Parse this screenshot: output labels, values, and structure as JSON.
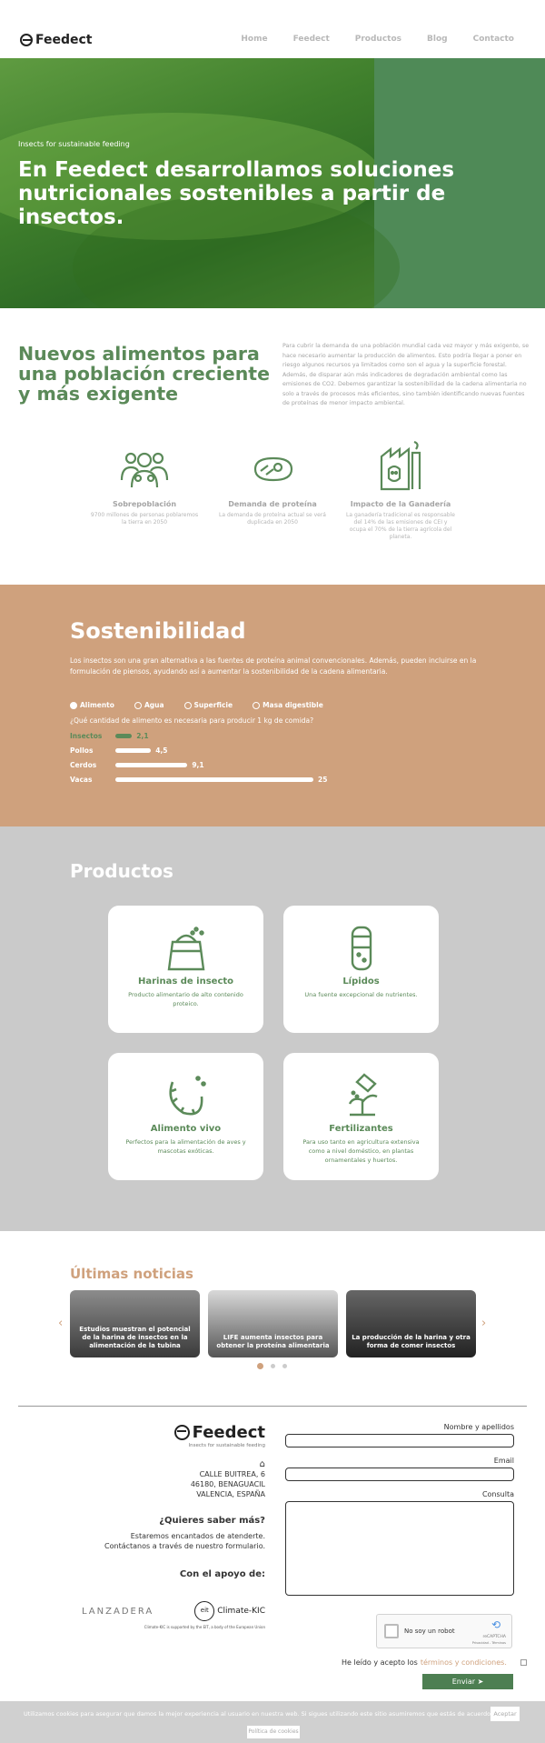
{
  "header": {
    "logo_text": "Feedect",
    "nav": [
      "Home",
      "Feedect",
      "Productos",
      "Blog",
      "Contacto"
    ]
  },
  "hero": {
    "kicker": "Insects for sustainable feeding",
    "title": "En Feedect desarrollamos soluciones nutricionales sostenibles a partir de insectos."
  },
  "intro": {
    "heading": "Nuevos alimentos para una población creciente y más exigente",
    "text": "Para cubrir la demanda de una población mundial cada vez mayor y más exigente, se hace necesario aumentar la producción de alimentos. Esto podría llegar a poner en riesgo algunos recursos ya limitados como son el agua y la superficie forestal. Además, de disparar aún más indicadores de degradación ambiental como las emisiones de CO2. Debemos garantizar la sostenibilidad de la cadena alimentaria no solo a través de procesos más eficientes, sino también identificando nuevas fuentes de proteínas de menor impacto ambiental."
  },
  "stats": [
    {
      "icon": "people-icon",
      "title": "Sobrepoblación",
      "desc": "9700 millones de personas poblaremos la tierra en 2050"
    },
    {
      "icon": "meat-icon",
      "title": "Demanda de proteína",
      "desc": "La demanda de proteína actual se verá duplicada en 2050"
    },
    {
      "icon": "factory-cow-icon",
      "title": "Impacto de la Ganadería",
      "desc": "La ganadería tradicional es responsable del 14% de las emisiones de CEI y ocupa el 70% de la tierra agrícola del planeta."
    }
  ],
  "sustainability": {
    "title": "Sostenibilidad",
    "text": "Los insectos son una gran alternativa a las fuentes de proteína animal convencionales. Además, pueden incluirse en la formulación de piensos, ayudando así a aumentar la sostenibilidad de la cadena alimentaria.",
    "options": [
      {
        "label": "Alimento",
        "selected": true
      },
      {
        "label": "Agua",
        "selected": false
      },
      {
        "label": "Superficie",
        "selected": false
      },
      {
        "label": "Masa digestible",
        "selected": false
      }
    ],
    "question": "¿Qué cantidad de alimento es necesaria para producir 1 kg de comida?",
    "bars": [
      {
        "label": "Insectos",
        "value": "2,1",
        "num": 2.1
      },
      {
        "label": "Pollos",
        "value": "4,5",
        "num": 4.5
      },
      {
        "label": "Cerdos",
        "value": "9,1",
        "num": 9.1
      },
      {
        "label": "Vacas",
        "value": "25",
        "num": 25
      }
    ]
  },
  "products": {
    "title": "Productos",
    "items": [
      {
        "icon": "flour-sack-icon",
        "title": "Harinas de insecto",
        "desc": "Producto alimentario de alto contenido proteico."
      },
      {
        "icon": "lipid-jar-icon",
        "title": "Lípidos",
        "desc": "Una fuente excepcional de nutrientes."
      },
      {
        "icon": "larva-icon",
        "title": "Alimento vivo",
        "desc": "Perfectos para la alimentación de aves y mascotas exóticas."
      },
      {
        "icon": "fertilizer-icon",
        "title": "Fertilizantes",
        "desc": "Para uso tanto en agricultura extensiva como a nivel doméstico, en plantas ornamentales y huertos."
      }
    ]
  },
  "news": {
    "title": "Últimas noticias",
    "items": [
      {
        "caption": "Estudios muestran el potencial de la harina de insectos en la alimentación de la tubina"
      },
      {
        "caption": "LIFE aumenta insectos para obtener la proteína alimentaria"
      },
      {
        "caption": "La producción de la harina y otra forma de comer insectos"
      }
    ]
  },
  "footer": {
    "logo_text": "Feedect",
    "tagline": "Insects for sustainable feeding",
    "address": [
      "CALLE BUITREA, 6",
      "46180, BENAGUACIL",
      "VALENCIA, ESPAÑA"
    ],
    "more_title": "¿Quieres saber más?",
    "more_text": [
      "Estaremos encantados de atenderte.",
      "Contáctanos a través de nuestro formulario."
    ],
    "support_title": "Con el apoyo de:",
    "partners": [
      "LANZADERA",
      "Climate-KIC"
    ],
    "partner_note": "Climate-KIC is supported by the EIT, a body of the European Union"
  },
  "form": {
    "name_label": "Nombre y apellidos",
    "email_label": "Email",
    "message_label": "Consulta",
    "captcha_label": "No soy un robot",
    "captcha_brand": "reCAPTCHA",
    "captcha_links": "Privacidad - Términos",
    "terms_text": "He leído y acepto los",
    "terms_link": "términos y condiciones.",
    "submit": "Enviar"
  },
  "cookie": {
    "text": "Utilizamos cookies para asegurar que damos la mejor experiencia al usuario en nuestra web. Si sigues utilizando este sitio asumiremos que estás de acuerdo.",
    "accept": "Aceptar",
    "policy": "Política de cookies"
  },
  "colors": {
    "green": "#5b8a59",
    "sand": "#cfa17d",
    "grey": "#cacaca"
  }
}
